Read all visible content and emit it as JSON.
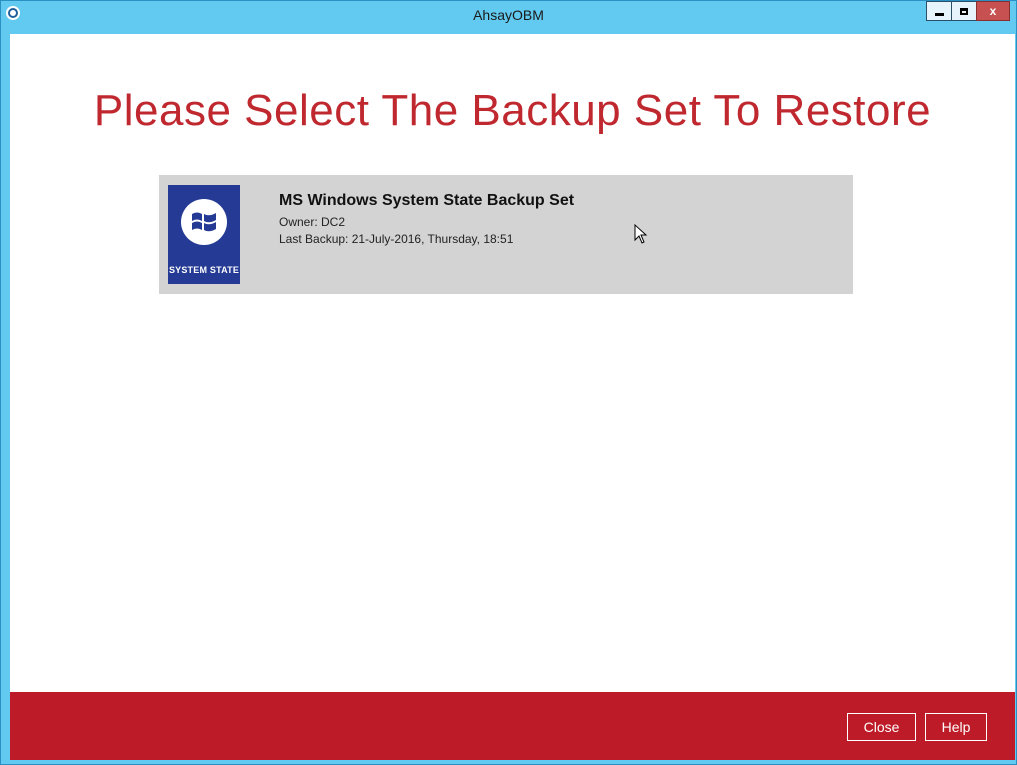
{
  "window": {
    "title": "AhsayOBM",
    "controls": {
      "minimize": "minimize",
      "maximize": "maximize",
      "close": "x"
    }
  },
  "main": {
    "heading": "Please Select The Backup Set To Restore",
    "backup_sets": [
      {
        "icon_label": "SYSTEM STATE",
        "icon": "windows-logo-icon",
        "name": "MS Windows System State Backup Set",
        "owner": "Owner: DC2",
        "last_backup": "Last Backup: 21-July-2016, Thursday, 18:51"
      }
    ]
  },
  "footer": {
    "close_label": "Close",
    "help_label": "Help"
  },
  "colors": {
    "titlebar": "#62c9f0",
    "accent_red": "#c0282f",
    "footer_red": "#bd1b27",
    "tile_blue": "#253a94",
    "card_gray": "#d3d3d3"
  }
}
